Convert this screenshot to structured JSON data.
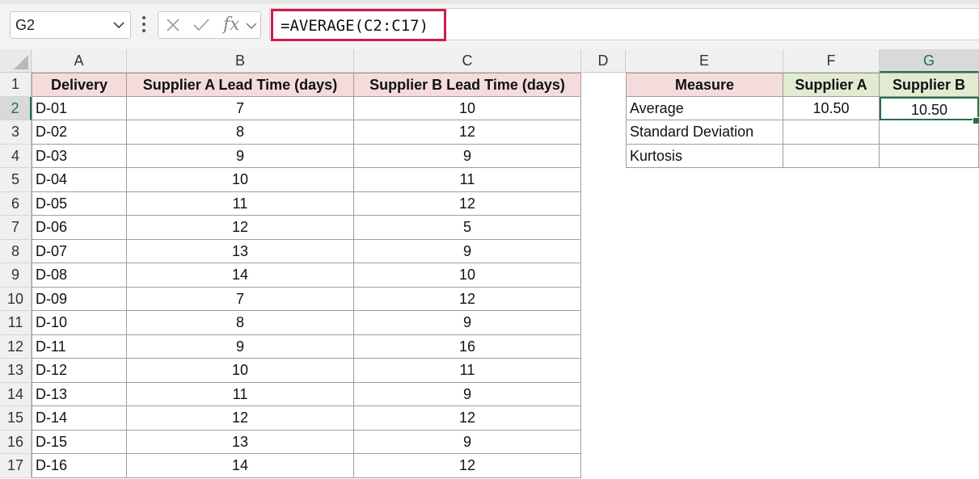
{
  "name_box": {
    "value": "G2"
  },
  "formula_bar": {
    "formula": "=AVERAGE(C2:C17)",
    "fx_label": "fx"
  },
  "columns": [
    "A",
    "B",
    "C",
    "D",
    "E",
    "F",
    "G"
  ],
  "rows": [
    "1",
    "2",
    "3",
    "4",
    "5",
    "6",
    "7",
    "8",
    "9",
    "10",
    "11",
    "12",
    "13",
    "14",
    "15",
    "16",
    "17"
  ],
  "main_table": {
    "headers": [
      "Delivery",
      "Supplier A Lead Time (days)",
      "Supplier B Lead Time (days)"
    ],
    "rows": [
      [
        "D-01",
        "7",
        "10"
      ],
      [
        "D-02",
        "8",
        "12"
      ],
      [
        "D-03",
        "9",
        "9"
      ],
      [
        "D-04",
        "10",
        "11"
      ],
      [
        "D-05",
        "11",
        "12"
      ],
      [
        "D-06",
        "12",
        "5"
      ],
      [
        "D-07",
        "13",
        "9"
      ],
      [
        "D-08",
        "14",
        "10"
      ],
      [
        "D-09",
        "7",
        "12"
      ],
      [
        "D-10",
        "8",
        "9"
      ],
      [
        "D-11",
        "9",
        "16"
      ],
      [
        "D-12",
        "10",
        "11"
      ],
      [
        "D-13",
        "11",
        "9"
      ],
      [
        "D-14",
        "12",
        "12"
      ],
      [
        "D-15",
        "13",
        "9"
      ],
      [
        "D-16",
        "14",
        "12"
      ]
    ]
  },
  "summary_table": {
    "headers": [
      "Measure",
      "Supplier A",
      "Supplier B"
    ],
    "rows": [
      [
        "Average",
        "10.50",
        "10.50"
      ],
      [
        "Standard Deviation",
        "",
        ""
      ],
      [
        "Kurtosis",
        "",
        ""
      ]
    ]
  },
  "colors": {
    "accent": "#217346",
    "highlight_border": "#d11a4a",
    "header_pink": "#f4dcdc",
    "header_green": "#e0ebd1"
  }
}
